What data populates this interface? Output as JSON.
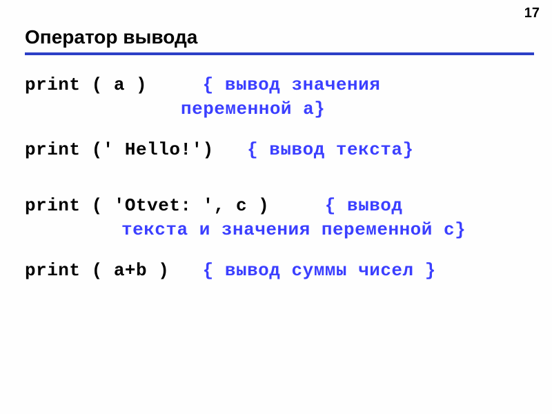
{
  "page_number": "17",
  "title": "Оператор вывода",
  "lines": {
    "l1a": "print ( a )",
    "l1b": "{ вывод значения",
    "l1c": "переменной a}",
    "l2a": "print (' Hello!')",
    "l2b": "{ вывод текста}",
    "l3a": "print ( 'Otvet: ', c )",
    "l3b": "{ вывод",
    "l3c": "текста и значения переменной c}",
    "l4a": "print ( a+b )",
    "l4b": "{ вывод суммы чисел }"
  }
}
